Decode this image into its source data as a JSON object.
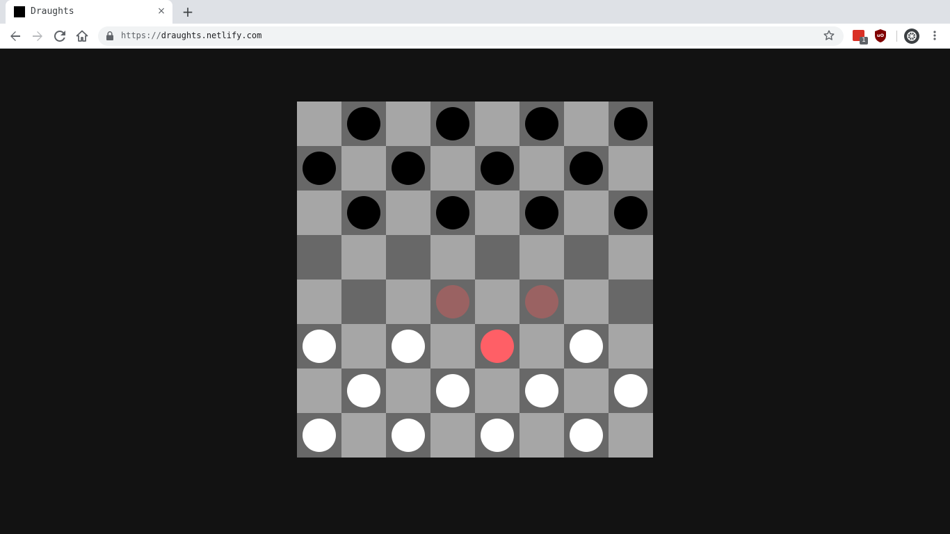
{
  "browser": {
    "tab_title": "Draughts",
    "tab_close": "×",
    "new_tab": "+",
    "url_scheme": "https://",
    "url_host": "draughts.netlify.com",
    "extension_badge": "1"
  },
  "game": {
    "board_size": 8,
    "colors": {
      "light_square": "#a6a6a6",
      "dark_square": "#686868",
      "black_piece": "#000000",
      "white_piece": "#ffffff",
      "selected_piece": "#ff5f66",
      "move_hint": "#9a6262",
      "background": "#121212"
    },
    "rows": [
      [
        "",
        "b",
        "",
        "b",
        "",
        "b",
        "",
        "b"
      ],
      [
        "b",
        "",
        "b",
        "",
        "b",
        "",
        "b",
        ""
      ],
      [
        "",
        "b",
        "",
        "b",
        "",
        "b",
        "",
        "b"
      ],
      [
        "",
        "",
        "",
        "",
        "",
        "",
        "",
        ""
      ],
      [
        "",
        "",
        "",
        "h",
        "",
        "h",
        "",
        ""
      ],
      [
        "w",
        "",
        "w",
        "",
        "s",
        "",
        "w",
        ""
      ],
      [
        "",
        "w",
        "",
        "w",
        "",
        "w",
        "",
        "w"
      ],
      [
        "w",
        "",
        "w",
        "",
        "w",
        "",
        "w",
        ""
      ]
    ]
  }
}
